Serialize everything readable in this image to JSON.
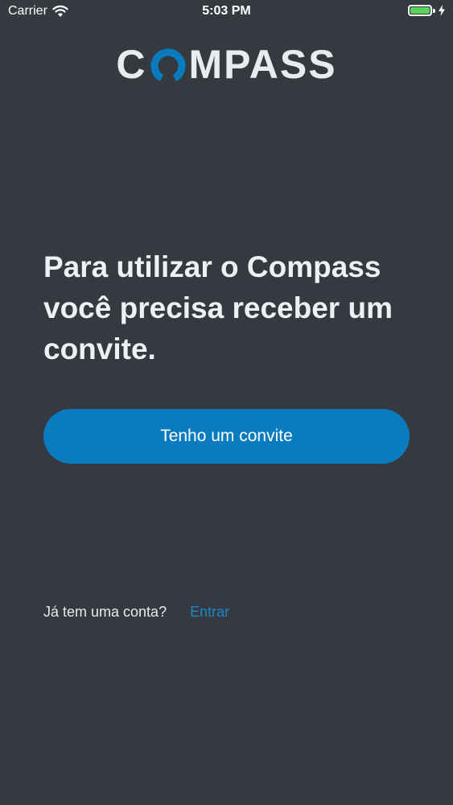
{
  "status_bar": {
    "carrier": "Carrier",
    "time": "5:03 PM",
    "battery_level": 1.0,
    "battery_color": "#5ad35a",
    "icons": [
      "wifi-icon",
      "battery-icon",
      "charging-bolt-icon"
    ]
  },
  "logo": {
    "text_before": "C",
    "text_after": "MPASS",
    "o_icon": "compass-o-ring-icon",
    "o_color": "#0b7bc0"
  },
  "headline": "Para utilizar o Compass você precisa receber um convite.",
  "primary_button": {
    "label": "Tenho um convite",
    "color": "#0b7bc0"
  },
  "footer": {
    "prompt": "Já tem uma conta?",
    "link": "Entrar",
    "link_color": "#1e86c8"
  },
  "colors": {
    "background": "#343a3f",
    "text": "#eef0f1"
  }
}
